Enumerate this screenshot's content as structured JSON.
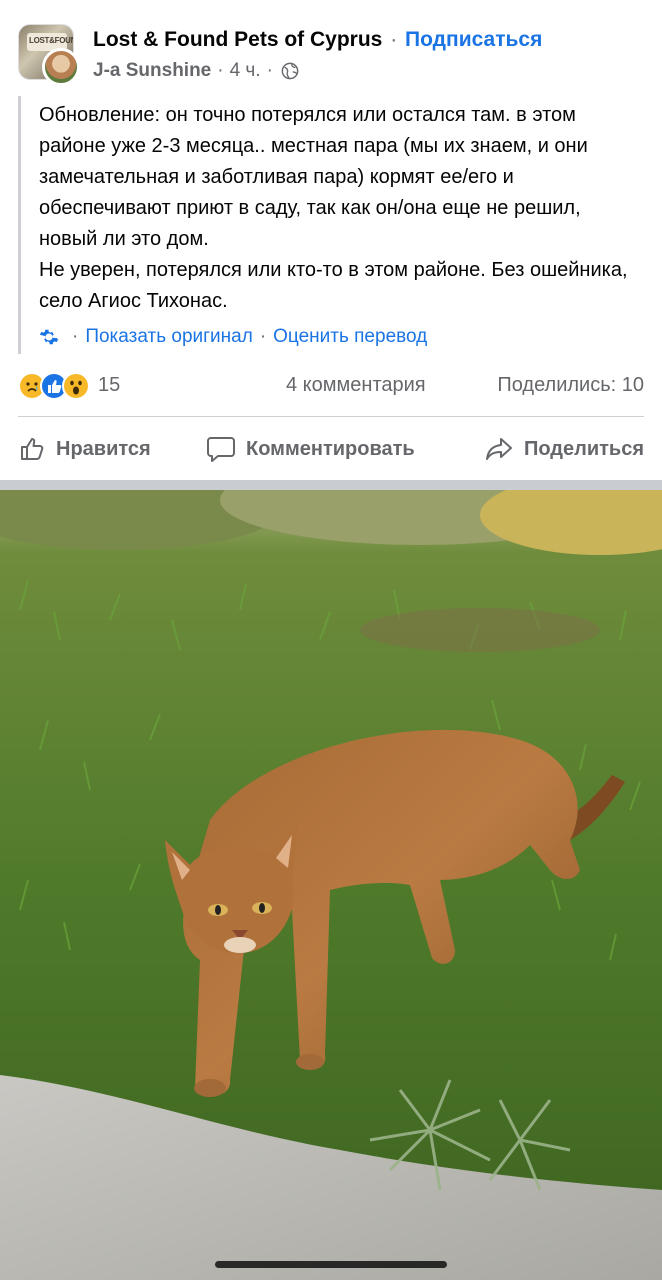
{
  "header": {
    "group_name": "Lost & Found Pets of Cyprus",
    "separator": "·",
    "subscribe": "Подписаться",
    "author": "J-a Sunshine",
    "time": "4 ч.",
    "avatar_sign_text": "LOST&FOUND",
    "icons": {
      "privacy": "globe-icon"
    }
  },
  "post": {
    "text_lines": [
      "Обновление: он точно потерялся или остался там. в этом районе уже 2-3 месяца.. местная пара (мы их знаем, и они замечательная и заботливая пара) кормят ее/его и обеспечивают приют в саду, так как он/она еще не решил, новый ли это дом.",
      "Не уверен, потерялся или кто-то в этом районе. Без ошейника, село Агиос Тихонас."
    ],
    "show_original": "Показать оригинал",
    "rate_translation": "Оценить перевод",
    "translate_separator": "·"
  },
  "stats": {
    "reaction_count": "15",
    "reactions": [
      "sad-reaction-icon",
      "like-reaction-icon",
      "wow-reaction-icon"
    ],
    "comments": "4 комментария",
    "shares": "Поделились: 10"
  },
  "actions": {
    "like": "Нравится",
    "comment": "Комментировать",
    "share": "Поделиться"
  },
  "photo": {
    "subject": "cat-photo"
  },
  "colors": {
    "link_blue": "#1b74e4",
    "secondary_text": "#65676b",
    "divider": "#ced0d4"
  }
}
